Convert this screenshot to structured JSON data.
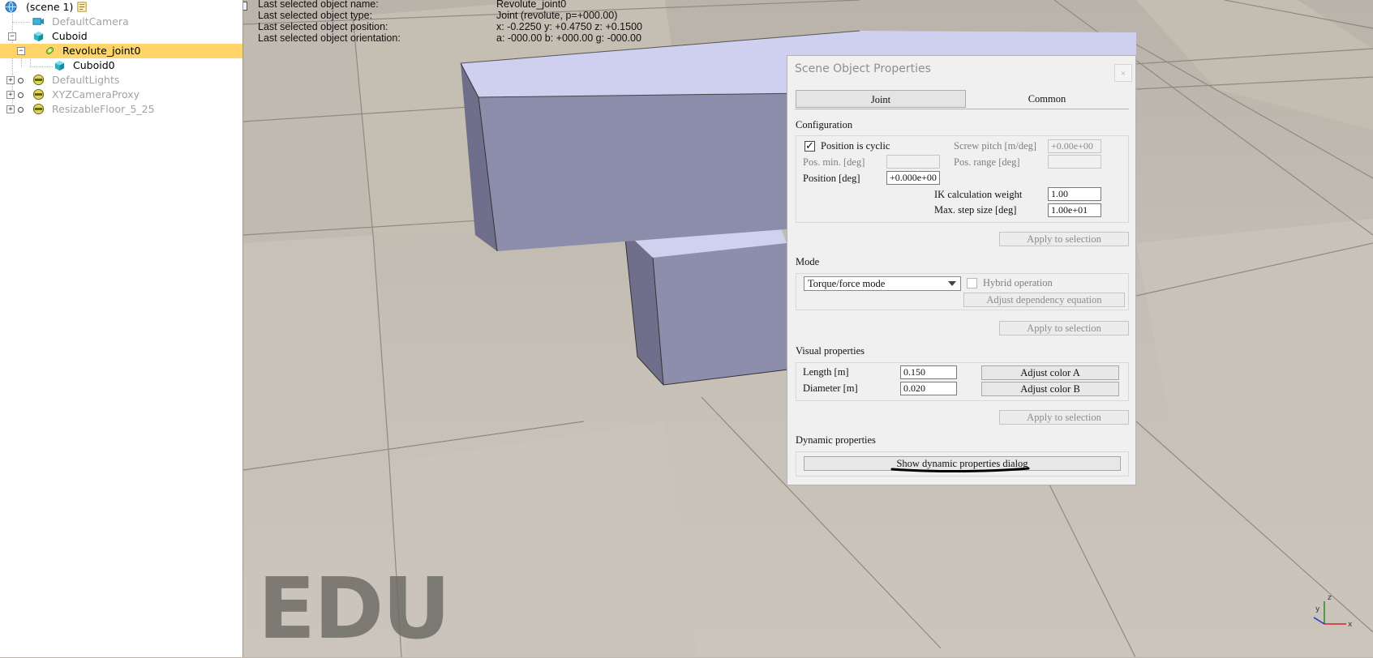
{
  "hierarchy": {
    "items": [
      {
        "label": "(scene 1)",
        "icon": "globe-icon"
      },
      {
        "label": "DefaultCamera",
        "icon": "camera-icon"
      },
      {
        "label": "Cuboid",
        "icon": "cuboid-icon"
      },
      {
        "label": "Revolute_joint0",
        "icon": "revolute-joint-icon",
        "selected": true
      },
      {
        "label": "Cuboid0",
        "icon": "cuboid-icon"
      },
      {
        "label": "DefaultLights",
        "icon": "lights-icon"
      },
      {
        "label": "XYZCameraProxy",
        "icon": "dummy-icon"
      },
      {
        "label": "ResizableFloor_5_25",
        "icon": "dummy-icon"
      }
    ],
    "scene_script_icon": "script-icon"
  },
  "info": {
    "name_label": "Last selected object name:",
    "name_value": "Revolute_joint0",
    "type_label": "Last selected object type:",
    "type_value": "Joint (revolute, p=+000.00)",
    "position_label": "Last selected object position:",
    "position_value": "x: -0.2250    y: +0.4750    z: +0.1500",
    "orientation_label": "Last selected object orientation:",
    "orientation_value": "a: -000.00    b: +000.00    g: -000.00"
  },
  "watermark": "EDU",
  "dialog": {
    "title": "Scene Object Properties",
    "close": "×",
    "tabs": [
      "Joint",
      "Common"
    ],
    "configuration": {
      "title": "Configuration",
      "position_cyclic_label": "Position is cyclic",
      "position_cyclic_checked": true,
      "screw_pitch_label": "Screw pitch [m/deg]",
      "screw_pitch_value": "+0.00e+00",
      "pos_min_label": "Pos. min. [deg]",
      "pos_min_value": "",
      "pos_range_label": "Pos. range [deg]",
      "pos_range_value": "",
      "position_label": "Position [deg]",
      "position_value": "+0.000e+00",
      "ik_weight_label": "IK calculation weight",
      "ik_weight_value": "1.00",
      "max_step_label": "Max. step size [deg]",
      "max_step_value": "1.00e+01",
      "apply": "Apply to selection"
    },
    "mode": {
      "title": "Mode",
      "selected": "Torque/force mode",
      "hybrid_label": "Hybrid operation",
      "adjust_dependency": "Adjust dependency equation",
      "apply": "Apply to selection"
    },
    "visual": {
      "title": "Visual properties",
      "length_label": "Length [m]",
      "length_value": "0.150",
      "diameter_label": "Diameter [m]",
      "diameter_value": "0.020",
      "color_a": "Adjust color A",
      "color_b": "Adjust color B",
      "apply": "Apply to selection"
    },
    "dynamic": {
      "title": "Dynamic properties",
      "show_dialog": "Show dynamic properties dialog"
    }
  },
  "colors": {
    "selection": "#ffd469",
    "cuboid_top": "#cfd0ef",
    "cuboid_side": "#8c8cab",
    "cuboid_dark": "#6f6f8c",
    "joint": "#b5341a",
    "floor": "#bcb6ac"
  }
}
